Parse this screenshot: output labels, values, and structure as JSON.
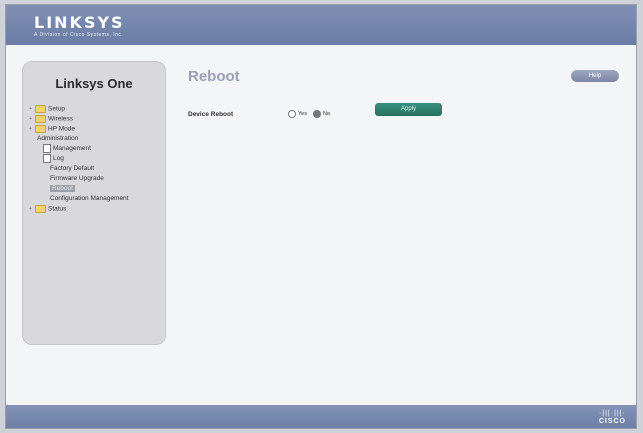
{
  "header": {
    "logo": "LINKSYS",
    "tagline": "A Division of Cisco Systems, Inc."
  },
  "sidebar": {
    "title": "Linksys One",
    "tree": [
      {
        "label": "Setup",
        "icon": "folder"
      },
      {
        "label": "Wireless",
        "icon": "folder"
      },
      {
        "label": "HP Mode",
        "icon": "folder"
      },
      {
        "label": "Administration",
        "icon": "none"
      },
      {
        "label": "Management",
        "icon": "doc"
      },
      {
        "label": "Log",
        "icon": "doc"
      },
      {
        "label": "Factory Default",
        "icon": "none"
      },
      {
        "label": "Firmware Upgrade",
        "icon": "none"
      },
      {
        "label": "Reboot",
        "icon": "none"
      },
      {
        "label": "Configuration Management",
        "icon": "none"
      },
      {
        "label": "Status",
        "icon": "folder"
      }
    ]
  },
  "main": {
    "title": "Reboot",
    "help_label": "Help",
    "device_reboot_label": "Device Reboot",
    "radio_yes": "Yes",
    "radio_no": "No",
    "apply_label": "Apply"
  },
  "footer": {
    "brand": "CISCO",
    "bars": "·|||·|||·"
  }
}
